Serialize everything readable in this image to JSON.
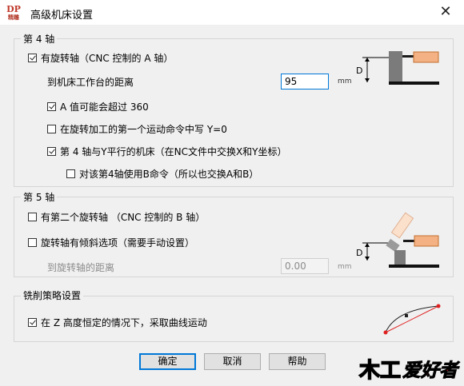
{
  "window": {
    "title": "高级机床设置",
    "logo_main": "DP",
    "logo_sub": "精雕",
    "close_glyph": "✕"
  },
  "axis4": {
    "group_label": "第 4 轴",
    "has_rotary": {
      "label": "有旋转轴（CNC 控制的 A 轴）",
      "checked": true
    },
    "distance_label": "到机床工作台的距离",
    "distance_value": "95",
    "distance_unit": "mm",
    "a_exceed": {
      "label": "A 值可能会超过 360",
      "checked": true
    },
    "write_y0": {
      "label": "在旋转加工的第一个运动命令中写 Y=0",
      "checked": false
    },
    "y_parallel": {
      "label": "第 4 轴与Y平行的机床（在NC文件中交换X和Y坐标）",
      "checked": true
    },
    "use_b": {
      "label": "对该第4轴使用B命令（所以也交换A和B）",
      "checked": false
    },
    "diagram_label": "D"
  },
  "axis5": {
    "group_label": "第 5 轴",
    "second_rotary": {
      "label": "有第二个旋转轴 （CNC 控制的 B 轴）",
      "checked": false
    },
    "tilt": {
      "label": "旋转轴有倾斜选项（需要手动设置）",
      "checked": false
    },
    "distance_label": "到旋转轴的距离",
    "distance_value": "0.00",
    "distance_unit": "mm",
    "diagram_label": "D"
  },
  "milling": {
    "group_label": "铣削策略设置",
    "curve_motion": {
      "label": "在 Z 高度恒定的情况下，采取曲线运动",
      "checked": true
    }
  },
  "buttons": {
    "ok": "确定",
    "cancel": "取消",
    "help": "帮助"
  },
  "watermark": {
    "text": "爱好者",
    "logo_text": "木工"
  }
}
